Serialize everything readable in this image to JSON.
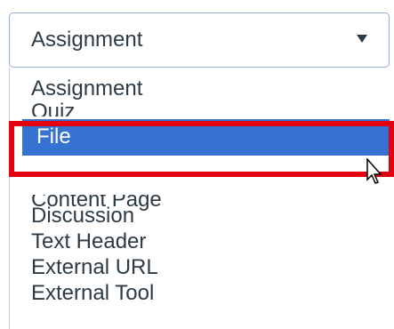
{
  "select": {
    "current_value": "Assignment"
  },
  "dropdown": {
    "options": [
      {
        "label": "Assignment"
      },
      {
        "label": "Quiz"
      },
      {
        "label": "File",
        "highlighted": true
      },
      {
        "label": "Content Page"
      },
      {
        "label": "Discussion"
      },
      {
        "label": "Text Header"
      },
      {
        "label": "External URL"
      },
      {
        "label": "External Tool"
      }
    ]
  },
  "colors": {
    "highlight_fill": "#3572d2",
    "annotation_outline": "#e3000f",
    "select_border": "#8fb1df",
    "text": "#2d3b45"
  },
  "icons": {
    "caret": "chevron-down-icon",
    "cursor": "mouse-pointer-icon"
  }
}
